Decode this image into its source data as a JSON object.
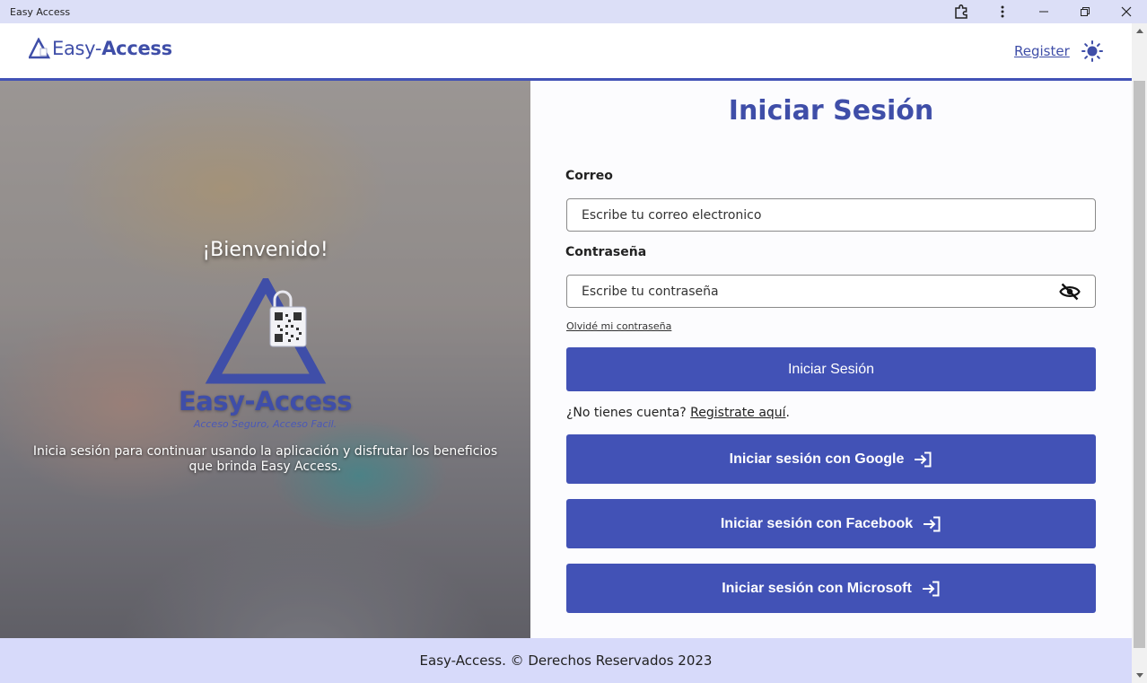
{
  "window": {
    "title": "Easy Access",
    "controls": [
      "extensions-icon",
      "more-menu-icon",
      "minimize-icon",
      "restore-icon",
      "close-icon"
    ]
  },
  "header": {
    "brand_light": "Easy-",
    "brand_bold": "Access",
    "register_link": "Register",
    "theme_icon": "sun-icon"
  },
  "hero": {
    "welcome": "¡Bienvenido!",
    "brand": "Easy-Access",
    "tagline": "Acceso Seguro, Acceso Facil.",
    "description": "Inicia sesión para continuar usando la aplicación y disfrutar los beneficios que brinda Easy Access."
  },
  "form": {
    "title": "Iniciar Sesión",
    "email_label": "Correo",
    "email_placeholder": "Escribe tu correo electronico",
    "password_label": "Contraseña",
    "password_placeholder": "Escribe tu contraseña",
    "forgot_link": "Olvidé mi contraseña",
    "submit_label": "Iniciar Sesión",
    "signup_prompt": "¿No tienes cuenta? ",
    "signup_link": "Registrate aquí",
    "signup_suffix": ".",
    "social": [
      {
        "label": "Iniciar sesión con Google"
      },
      {
        "label": "Iniciar sesión con Facebook"
      },
      {
        "label": "Iniciar sesión con Microsoft"
      }
    ]
  },
  "footer": {
    "text": "Easy-Access. © Derechos Reservados 2023"
  },
  "colors": {
    "accent": "#4252b6",
    "brand_text": "#3f4ea8",
    "titlebar": "#dcdff7",
    "footer": "#d7dafa"
  }
}
